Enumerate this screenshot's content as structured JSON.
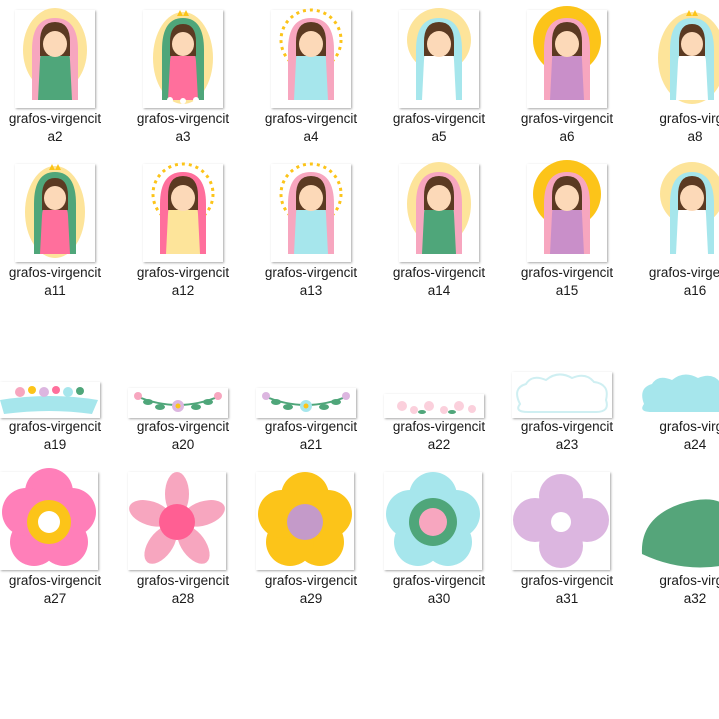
{
  "files": [
    {
      "line1": "grafos-virgencit",
      "line2": "a2"
    },
    {
      "line1": "grafos-virgencit",
      "line2": "a3"
    },
    {
      "line1": "grafos-virgencit",
      "line2": "a4"
    },
    {
      "line1": "grafos-virgencit",
      "line2": "a5"
    },
    {
      "line1": "grafos-virgencit",
      "line2": "a6"
    },
    {
      "line1": "grafos-virge",
      "line2": "a8"
    },
    {
      "line1": "grafos-virgencit",
      "line2": "a11"
    },
    {
      "line1": "grafos-virgencit",
      "line2": "a12"
    },
    {
      "line1": "grafos-virgencit",
      "line2": "a13"
    },
    {
      "line1": "grafos-virgencit",
      "line2": "a14"
    },
    {
      "line1": "grafos-virgencit",
      "line2": "a15"
    },
    {
      "line1": "grafos-virgencit",
      "line2": "a16"
    },
    {
      "line1": "grafos-virgencit",
      "line2": "a19"
    },
    {
      "line1": "grafos-virgencit",
      "line2": "a20"
    },
    {
      "line1": "grafos-virgencit",
      "line2": "a21"
    },
    {
      "line1": "grafos-virgencit",
      "line2": "a22"
    },
    {
      "line1": "grafos-virgencit",
      "line2": "a23"
    },
    {
      "line1": "grafos-virge",
      "line2": "a24"
    },
    {
      "line1": "grafos-virgencit",
      "line2": "a27"
    },
    {
      "line1": "grafos-virgencit",
      "line2": "a28"
    },
    {
      "line1": "grafos-virgencit",
      "line2": "a29"
    },
    {
      "line1": "grafos-virgencit",
      "line2": "a30"
    },
    {
      "line1": "grafos-virgencit",
      "line2": "a31"
    },
    {
      "line1": "grafos-virge",
      "line2": "a32"
    }
  ],
  "colors": {
    "halo_yellow": "#fde49a",
    "pink_mantle": "#f7a6bf",
    "green_mantle": "#4fa67a",
    "aqua_mantle": "#a6e6ec",
    "lilac_dress": "#c98fc9",
    "hot_pink": "#ff6f9c",
    "flower_yellow": "#fcc419",
    "lavender": "#dcb6e0",
    "leaf_green": "#55a57a"
  }
}
